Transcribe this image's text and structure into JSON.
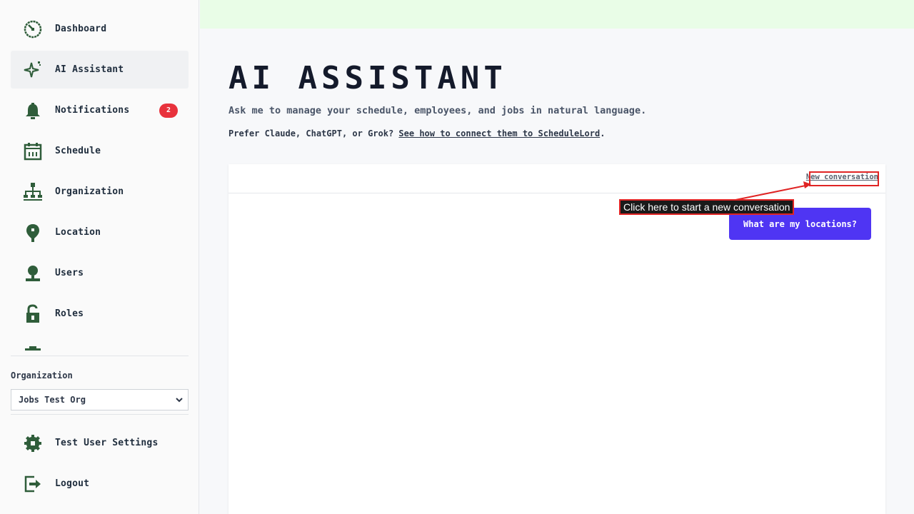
{
  "sidebar": {
    "items": [
      {
        "label": "Dashboard",
        "icon": "dashboard-icon"
      },
      {
        "label": "AI Assistant",
        "icon": "sparkle-icon",
        "active": true
      },
      {
        "label": "Notifications",
        "icon": "bell-icon",
        "badge": "2"
      },
      {
        "label": "Schedule",
        "icon": "calendar-icon"
      },
      {
        "label": "Organization",
        "icon": "org-chart-icon"
      },
      {
        "label": "Location",
        "icon": "location-pin-icon"
      },
      {
        "label": "Users",
        "icon": "user-icon"
      },
      {
        "label": "Roles",
        "icon": "lock-icon"
      }
    ],
    "organization_label": "Organization",
    "organization_value": "Jobs Test Org",
    "settings_label": "Test User Settings",
    "logout_label": "Logout"
  },
  "main": {
    "title": "AI ASSISTANT",
    "subtitle": "Ask me to manage your schedule, employees, and jobs in natural language.",
    "hint_prefix": "Prefer Claude, ChatGPT, or Grok? ",
    "hint_link": "See how to connect them to ScheduleLord",
    "hint_suffix": ".",
    "new_conversation": "New conversation",
    "message": "What are my locations?"
  },
  "annotation": {
    "text": "Click here to start a new conversation"
  },
  "colors": {
    "icon_green": "#2f5d3a",
    "accent_purple": "#4f35f3",
    "badge_red": "#e8323c",
    "topbar_green": "#e9fde7"
  }
}
